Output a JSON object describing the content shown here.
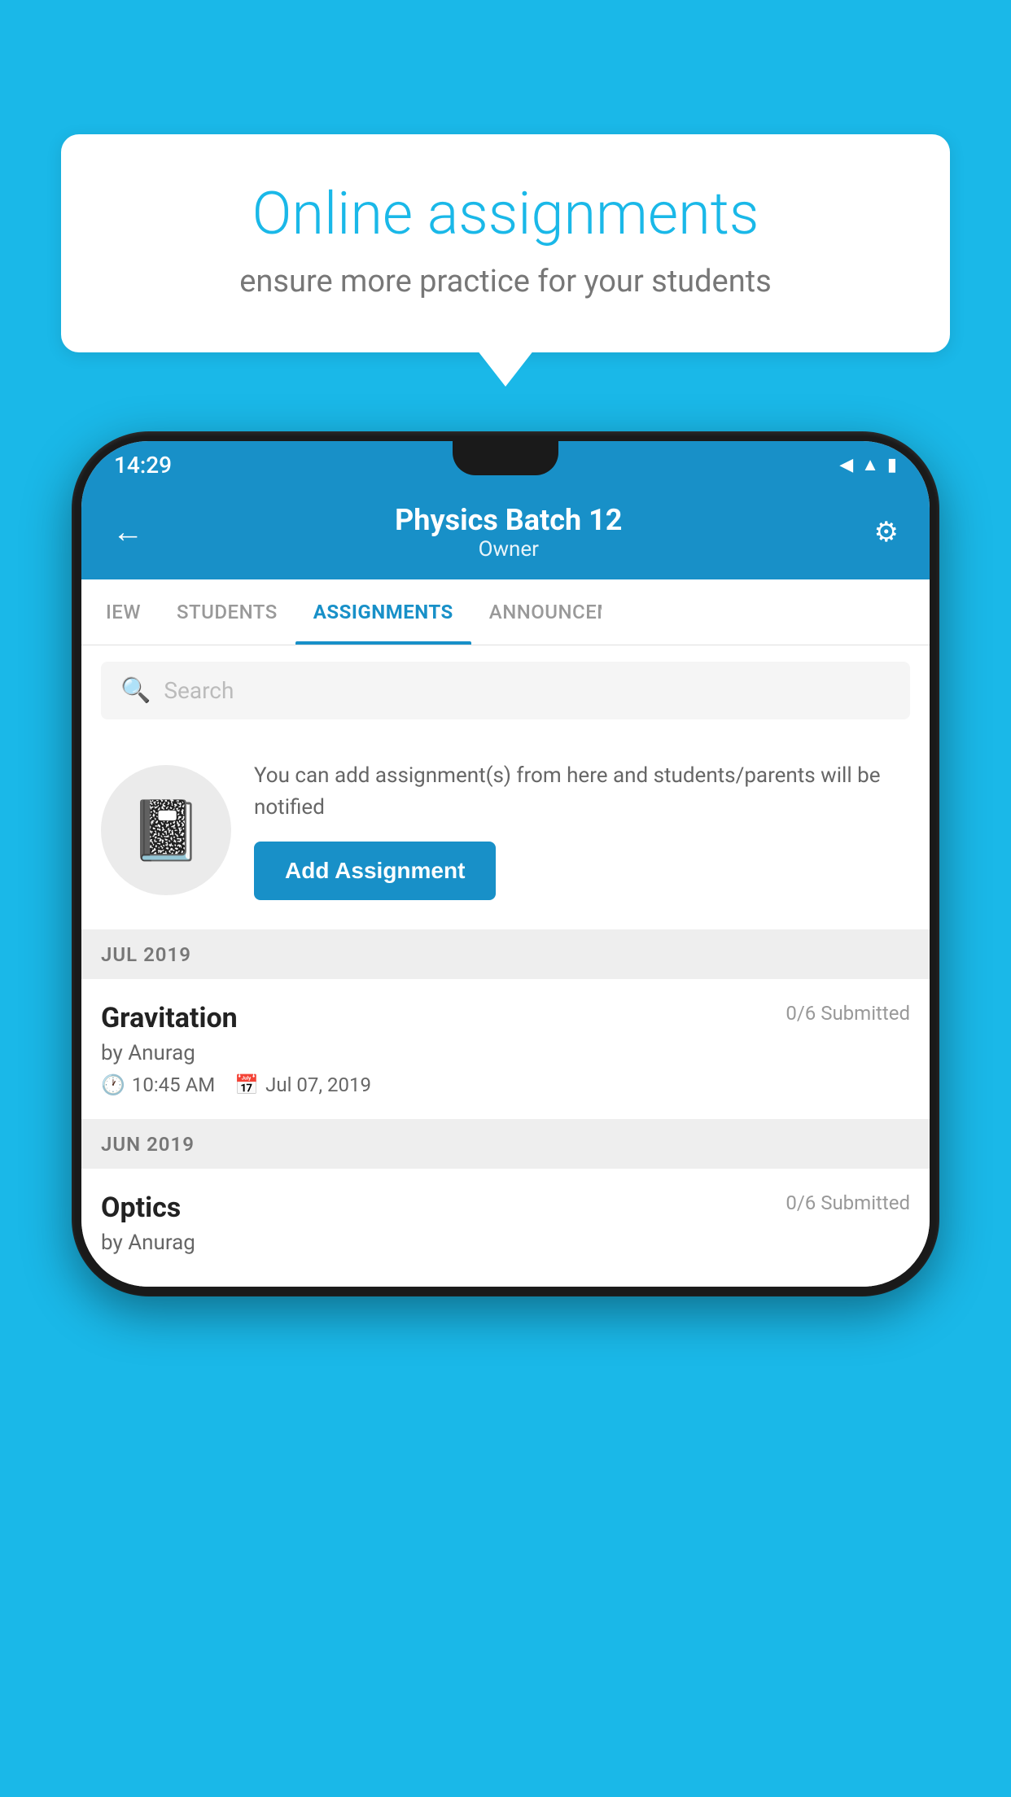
{
  "background_color": "#1ab8e8",
  "speech_bubble": {
    "title": "Online assignments",
    "subtitle": "ensure more practice for your students"
  },
  "phone": {
    "status_bar": {
      "time": "14:29",
      "wifi": "▲",
      "signal": "▲",
      "battery": "▮"
    },
    "header": {
      "title": "Physics Batch 12",
      "subtitle": "Owner",
      "back_label": "←",
      "settings_label": "⚙"
    },
    "tabs": [
      {
        "label": "IEW",
        "active": false
      },
      {
        "label": "STUDENTS",
        "active": false
      },
      {
        "label": "ASSIGNMENTS",
        "active": true
      },
      {
        "label": "ANNOUNCEM...",
        "active": false
      }
    ],
    "search": {
      "placeholder": "Search"
    },
    "promo": {
      "description": "You can add assignment(s) from here and students/parents will be notified",
      "button_label": "Add Assignment"
    },
    "sections": [
      {
        "label": "JUL 2019",
        "assignments": [
          {
            "name": "Gravitation",
            "submitted": "0/6 Submitted",
            "by": "by Anurag",
            "time": "10:45 AM",
            "date": "Jul 07, 2019"
          }
        ]
      },
      {
        "label": "JUN 2019",
        "assignments": [
          {
            "name": "Optics",
            "submitted": "0/6 Submitted",
            "by": "by Anurag",
            "time": "",
            "date": ""
          }
        ]
      }
    ]
  }
}
